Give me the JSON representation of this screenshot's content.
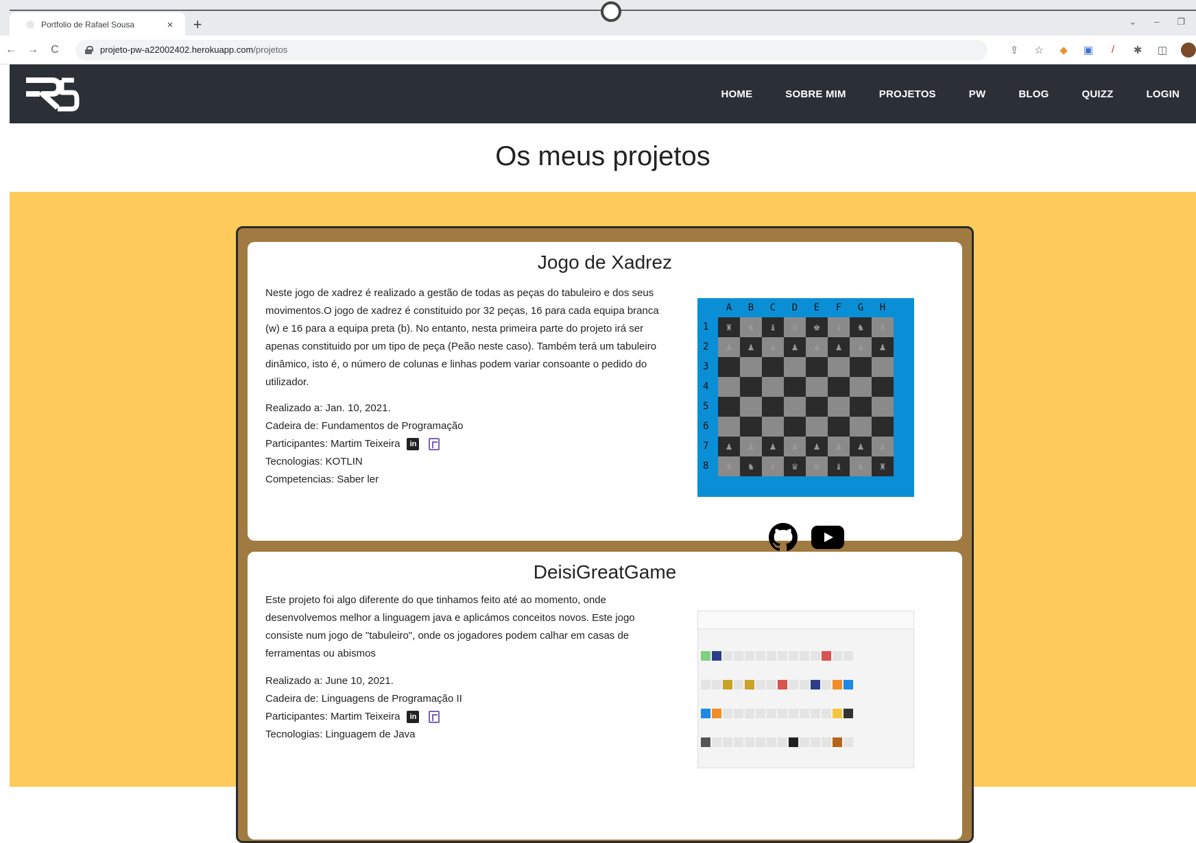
{
  "browser": {
    "tab_title": "Portfolio de Rafael Sousa",
    "tab_close": "×",
    "new_tab": "+",
    "url_host": "projeto-pw-a22002402.herokuapp.com",
    "url_path": "/projetos",
    "window_controls": [
      "⌄",
      "–",
      "❐"
    ]
  },
  "nav": {
    "logo_text": "RS",
    "items": [
      "HOME",
      "SOBRE MIM",
      "PROJETOS",
      "PW",
      "BLOG",
      "QUIZZ",
      "LOGIN"
    ]
  },
  "page": {
    "title": "Os meus projetos"
  },
  "projects": [
    {
      "title": "Jogo de Xadrez",
      "description": "Neste jogo de xadrez é realizado a gestão de todas as peças do tabuleiro e dos seus movimentos.O jogo de xadrez é constituido por 32 peças, 16 para cada equipa branca (w) e 16 para a equipa preta (b). No entanto, nesta primeira parte do projeto irá ser apenas constituido por um tipo de peça (Peão neste caso). Também terá um tabuleiro dinâmico, isto é, o número de colunas e linhas podem variar consoante o pedido do utilizador.",
      "date": "Realizado a: Jan. 10, 2021.",
      "subject": "Cadeira de: Fundamentos de Programação",
      "participants": "Participantes: Martim Teixeira",
      "technologies": "Tecnologias: KOTLIN",
      "skills": "Competencias: Saber ler",
      "board_cols": [
        "A",
        "B",
        "C",
        "D",
        "E",
        "F",
        "G",
        "H"
      ],
      "board_rows": [
        "1",
        "2",
        "3",
        "4",
        "5",
        "6",
        "7",
        "8"
      ]
    },
    {
      "title": "DeisiGreatGame",
      "description": "Este projeto foi algo diferente do que tinhamos feito até ao momento, onde desenvolvemos melhor a linguagem java e aplicámos conceitos novos. Este jogo consiste num jogo de \"tabuleiro\", onde os jogadores podem calhar em casas de ferramentas ou abismos",
      "date": "Realizado a: June 10, 2021.",
      "subject": "Cadeira de: Linguagens de Programação II",
      "participants": "Participantes: Martim Teixeira",
      "technologies": "Tecnologias: Linguagem de Java"
    }
  ],
  "colors": {
    "navbar": "#2b3036",
    "content_bg": "#fecb5a",
    "card_frame": "#a07a40",
    "board_frame": "#0a8fd6"
  }
}
